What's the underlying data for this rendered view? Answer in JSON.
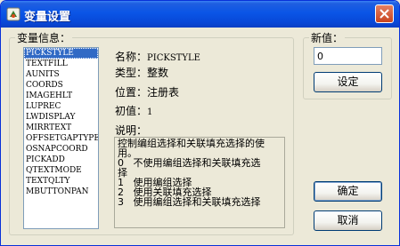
{
  "window": {
    "title": "变量设置"
  },
  "variables_group": {
    "title": "变量信息：",
    "list": [
      "PICKSTYLE",
      "TEXTFILL",
      "AUNITS",
      "COORDS",
      "IMAGEHLT",
      "LUPREC",
      "LWDISPLAY",
      "MIRRTEXT",
      "OFFSETGAPTYPE",
      "OSNAPCOORD",
      "PICKADD",
      "QTEXTMODE",
      "TEXTQLTY",
      "MBUTTONPAN"
    ],
    "selected": "PICKSTYLE",
    "name_label": "名称：",
    "name_value": "PICKSTYLE",
    "type_label": "类型：",
    "type_value": "整数",
    "location_label": "位置：",
    "location_value": "注册表",
    "initial_label": "初值：",
    "initial_value": "1",
    "description_label": "说明：",
    "description_lines": [
      "控制编组选择和关联填充选择的使",
      "用。",
      "0   不使用编组选择和关联填充选",
      "择",
      "1   使用编组选择",
      "2   使用关联填充选择",
      "3   使用编组选择和关联填充选择"
    ]
  },
  "new_value_group": {
    "title": "新值：",
    "value": "0",
    "set_button": "设定"
  },
  "buttons": {
    "ok": "确定",
    "cancel": "取消"
  },
  "colors": {
    "titlebar": "#0a55e6",
    "selection": "#316ac5",
    "dialog_bg": "#ece9d8"
  }
}
